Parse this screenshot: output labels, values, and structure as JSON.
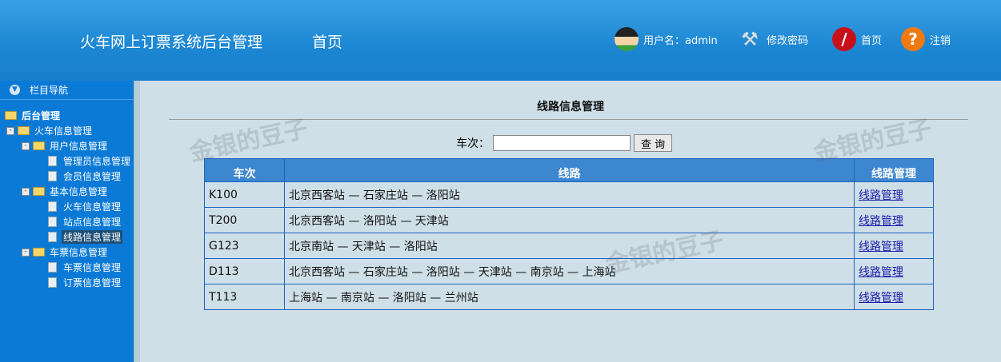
{
  "header": {
    "title": "火车网上订票系统后台管理",
    "home": "首页",
    "user_label": "用户名：admin",
    "change_pwd": "修改密码",
    "home_btn": "首页",
    "logout": "注销"
  },
  "sidebar": {
    "nav_title": "栏目导航",
    "root": "后台管理",
    "groups": [
      {
        "label": "火车信息管理"
      },
      {
        "label": "用户信息管理",
        "items": [
          "管理员信息管理",
          "会员信息管理"
        ]
      },
      {
        "label": "基本信息管理",
        "items": [
          "火车信息管理",
          "站点信息管理",
          "线路信息管理"
        ]
      },
      {
        "label": "车票信息管理",
        "items": [
          "车票信息管理",
          "订票信息管理"
        ]
      }
    ]
  },
  "main": {
    "title": "线路信息管理",
    "search_label": "车次：",
    "search_value": "",
    "search_button": "查 询",
    "columns": [
      "车次",
      "线路",
      "线路管理"
    ],
    "rows": [
      {
        "train": "K100",
        "route": "北京西客站 — 石家庄站 — 洛阳站",
        "action": "线路管理"
      },
      {
        "train": "T200",
        "route": "北京西客站 — 洛阳站 — 天津站",
        "action": "线路管理"
      },
      {
        "train": "G123",
        "route": "北京南站 — 天津站 — 洛阳站",
        "action": "线路管理"
      },
      {
        "train": "D113",
        "route": "北京西客站 — 石家庄站 — 洛阳站 — 天津站 — 南京站 — 上海站",
        "action": "线路管理"
      },
      {
        "train": "T113",
        "route": "上海站 — 南京站 — 洛阳站 — 兰州站",
        "action": "线路管理"
      }
    ]
  },
  "watermark": "金银的豆子"
}
